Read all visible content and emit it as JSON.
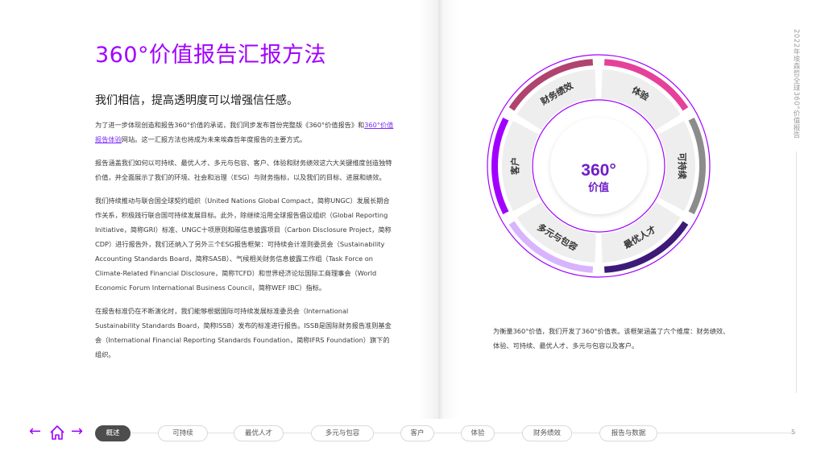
{
  "header": {
    "title": "360°价值报告汇报方法",
    "subtitle": "我们相信，提高透明度可以增强信任感。",
    "side_label": "2022年埃森哲全球360°价值报告"
  },
  "body": {
    "p1_a": "为了进一步体现创造和报告360°价值的承诺，我们同步发布首份完整版《360°价值报告》和",
    "p1_link": "360°价值报告体验",
    "p1_b": "网站。这一汇报方法也将成为未来埃森哲年度报告的主要方式。",
    "p2": "报告涵盖我们如何以可持续、最优人才、多元与包容、客户、体验和财务绩效这六大关键维度创造独特价值，并全面展示了我们的环境、社会和治理（ESG）与财务指标，以及我们的目标、进展和绩效。",
    "p3": "我们持续推动与联合国全球契约组织（United Nations Global Compact，简称UNGC）发展长期合作关系，积极践行联合国可持续发展目标。此外，除继续沿用全球报告倡议组织（Global Reporting Initiative，简称GRI）标准、UNGC十项原则和碳信息披露项目（Carbon Disclosure Project，简称CDP）进行报告外，我们还纳入了另外三个ESG报告框架：可持续会计准则委员会（Sustainability Accounting Standards Board，简称SASB）、气候相关财务信息披露工作组（Task Force on Climate-Related Financial Disclosure，简称TCFD）和世界经济论坛国际工商理事会（World Economic Forum International Business Council，简称WEF IBC）指标。",
    "p4": "在报告标准仍在不断演化时，我们能够根据国际可持续发展标准委员会（International Sustainability Standards Board，简称ISSB）发布的标准进行报告。ISSB是国际财务报告准则基金会（International Financial Reporting Standards Foundation，简称IFRS Foundation）旗下的组织。"
  },
  "wheel": {
    "center_big": "360°",
    "center_small": "价值",
    "segments": [
      "体验",
      "可持续",
      "最优人才",
      "多元与包容",
      "客户",
      "财务绩效"
    ],
    "arc_colors": [
      "#e6419a",
      "#8c8c8c",
      "#3d1a78",
      "#d8b4fe",
      "#a100ff",
      "#b0436f"
    ]
  },
  "caption": "为衡量360°价值，我们开发了360°价值表。该框架涵盖了六个维度：财务绩效、体验、可持续、最优人才、多元与包容以及客户。",
  "nav": {
    "tabs": [
      "概述",
      "可持续",
      "最优人才",
      "多元与包容",
      "客户",
      "体验",
      "财务绩效",
      "报告与数据"
    ],
    "active_index": 0,
    "page_number": "5",
    "prev_arrow": "←",
    "next_arrow": "→"
  },
  "colors": {
    "accent": "#a100ff",
    "active_tab": "#4d4d4d"
  }
}
